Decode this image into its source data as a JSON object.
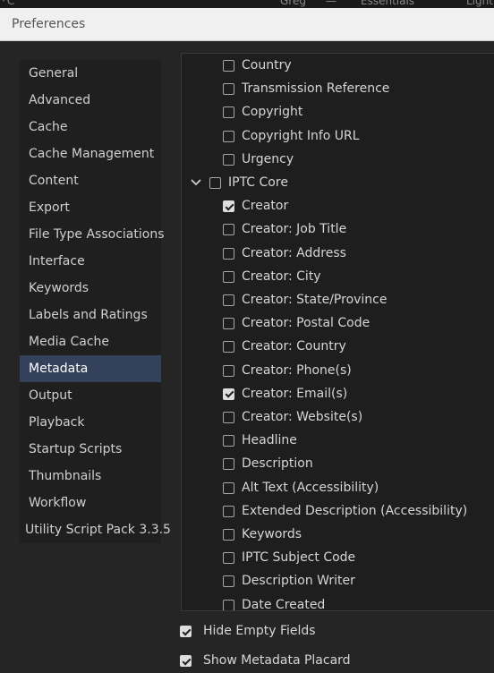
{
  "topbar": {
    "logo": "·C",
    "user": "Greg",
    "dash": "—",
    "workspace": "Essentials",
    "light": "Light"
  },
  "dialog": {
    "title": "Preferences"
  },
  "sidebar": {
    "selected": "Metadata",
    "items": [
      {
        "label": "General"
      },
      {
        "label": "Advanced"
      },
      {
        "label": "Cache"
      },
      {
        "label": "Cache Management"
      },
      {
        "label": "Content"
      },
      {
        "label": "Export"
      },
      {
        "label": "File Type Associations"
      },
      {
        "label": "Interface"
      },
      {
        "label": "Keywords"
      },
      {
        "label": "Labels and Ratings"
      },
      {
        "label": "Media Cache"
      },
      {
        "label": "Metadata"
      },
      {
        "label": "Output"
      },
      {
        "label": "Playback"
      },
      {
        "label": "Startup Scripts"
      },
      {
        "label": "Thumbnails"
      },
      {
        "label": "Workflow"
      },
      {
        "label": "Utility Script Pack 3.3.5"
      }
    ]
  },
  "metadata_fields": {
    "items": [
      {
        "label": "Country",
        "checked": false,
        "level": 2
      },
      {
        "label": "Transmission Reference",
        "checked": false,
        "level": 2
      },
      {
        "label": "Copyright",
        "checked": false,
        "level": 2
      },
      {
        "label": "Copyright Info URL",
        "checked": false,
        "level": 2
      },
      {
        "label": "Urgency",
        "checked": false,
        "level": 2
      },
      {
        "label": "IPTC Core",
        "checked": false,
        "level": 1,
        "expanded": true
      },
      {
        "label": "Creator",
        "checked": true,
        "level": 2
      },
      {
        "label": "Creator: Job Title",
        "checked": false,
        "level": 2
      },
      {
        "label": "Creator: Address",
        "checked": false,
        "level": 2
      },
      {
        "label": "Creator: City",
        "checked": false,
        "level": 2
      },
      {
        "label": "Creator: State/Province",
        "checked": false,
        "level": 2
      },
      {
        "label": "Creator: Postal Code",
        "checked": false,
        "level": 2
      },
      {
        "label": "Creator: Country",
        "checked": false,
        "level": 2
      },
      {
        "label": "Creator: Phone(s)",
        "checked": false,
        "level": 2
      },
      {
        "label": "Creator: Email(s)",
        "checked": true,
        "level": 2
      },
      {
        "label": "Creator: Website(s)",
        "checked": false,
        "level": 2
      },
      {
        "label": "Headline",
        "checked": false,
        "level": 2
      },
      {
        "label": "Description",
        "checked": false,
        "level": 2
      },
      {
        "label": "Alt Text (Accessibility)",
        "checked": false,
        "level": 2
      },
      {
        "label": "Extended Description (Accessibility)",
        "checked": false,
        "level": 2
      },
      {
        "label": "Keywords",
        "checked": false,
        "level": 2
      },
      {
        "label": "IPTC Subject Code",
        "checked": false,
        "level": 2
      },
      {
        "label": "Description Writer",
        "checked": false,
        "level": 2
      },
      {
        "label": "Date Created",
        "checked": false,
        "level": 2
      }
    ]
  },
  "options": {
    "hide_empty_fields": {
      "label": "Hide Empty Fields",
      "checked": true
    },
    "show_metadata_placard": {
      "label": "Show Metadata Placard",
      "checked": true
    }
  },
  "icons": {
    "expand": "chevron-down-icon",
    "checkbox": "checkbox-icon"
  },
  "colors": {
    "selected_bg": "#34415a",
    "panel_bg": "#1e1e1e",
    "dialog_bg": "#252525",
    "titlebar_bg": "#f0f0f0"
  }
}
